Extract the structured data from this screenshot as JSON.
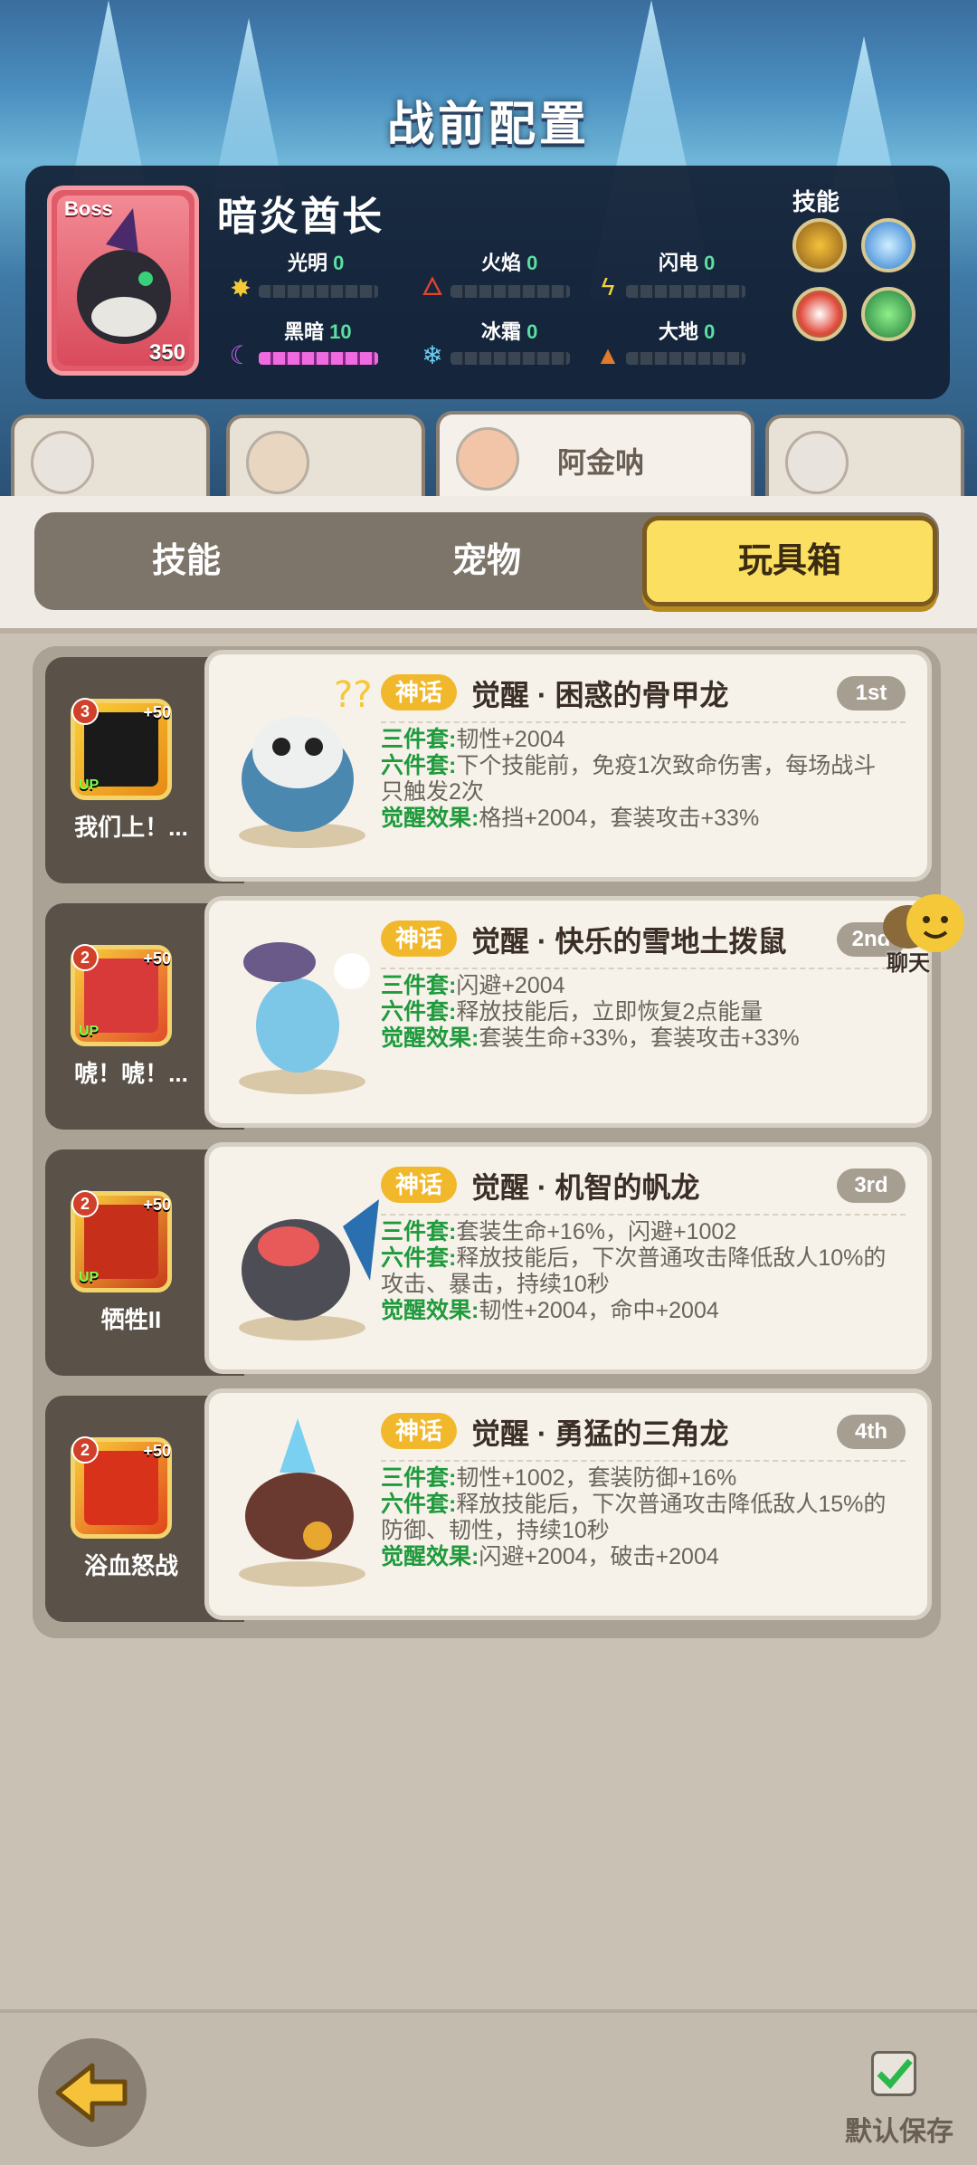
{
  "header": {
    "title": "战前配置"
  },
  "boss": {
    "tag": "Boss",
    "name": "暗炎酋长",
    "level": "350",
    "skills_label": "技能",
    "stats": {
      "light": {
        "label": "光明",
        "value": "0"
      },
      "fire": {
        "label": "火焰",
        "value": "0"
      },
      "lightning": {
        "label": "闪电",
        "value": "0"
      },
      "dark": {
        "label": "黑暗",
        "value": "10"
      },
      "ice": {
        "label": "冰霜",
        "value": "0"
      },
      "earth": {
        "label": "大地",
        "value": "0"
      }
    }
  },
  "character_tabs": {
    "active_name": "阿金呐"
  },
  "segments": {
    "skill": "技能",
    "pet": "宠物",
    "toybox": "玩具箱"
  },
  "rows": [
    {
      "skill_name": "我们上！...",
      "skill_level": "3",
      "skill_plus": "+50",
      "skill_up": "UP",
      "badge": "神话",
      "toy_name": "觉醒 · 困惑的骨甲龙",
      "rank": "1st",
      "l1k": "三件套:",
      "l1": "韧性+2004",
      "l2k": "六件套:",
      "l2": "下个技能前，免疫1次致命伤害，每场战斗只触发2次",
      "l3k": "觉醒效果:",
      "l3": "格挡+2004，套装攻击+33%"
    },
    {
      "skill_name": "唬！唬！...",
      "skill_level": "2",
      "skill_plus": "+50",
      "skill_up": "UP",
      "badge": "神话",
      "toy_name": "觉醒 · 快乐的雪地土拨鼠",
      "rank": "2nd",
      "l1k": "三件套:",
      "l1": "闪避+2004",
      "l2k": "六件套:",
      "l2": "释放技能后，立即恢复2点能量",
      "l3k": "觉醒效果:",
      "l3": "套装生命+33%，套装攻击+33%"
    },
    {
      "skill_name": "牺牲II",
      "skill_level": "2",
      "skill_plus": "+50",
      "skill_up": "UP",
      "badge": "神话",
      "toy_name": "觉醒 · 机智的帆龙",
      "rank": "3rd",
      "l1k": "三件套:",
      "l1": "套装生命+16%，闪避+1002",
      "l2k": "六件套:",
      "l2": "释放技能后，下次普通攻击降低敌人10%的攻击、暴击，持续10秒",
      "l3k": "觉醒效果:",
      "l3": "韧性+2004，命中+2004"
    },
    {
      "skill_name": "浴血怒战",
      "skill_level": "2",
      "skill_plus": "+50",
      "skill_up": "",
      "badge": "神话",
      "toy_name": "觉醒 · 勇猛的三角龙",
      "rank": "4th",
      "l1k": "三件套:",
      "l1": "韧性+1002，套装防御+16%",
      "l2k": "六件套:",
      "l2": "释放技能后，下次普通攻击降低敌人15%的防御、韧性，持续10秒",
      "l3k": "觉醒效果:",
      "l3": "闪避+2004，破击+2004"
    }
  ],
  "chat": {
    "label": "聊天"
  },
  "footer": {
    "save_label": "默认保存"
  }
}
